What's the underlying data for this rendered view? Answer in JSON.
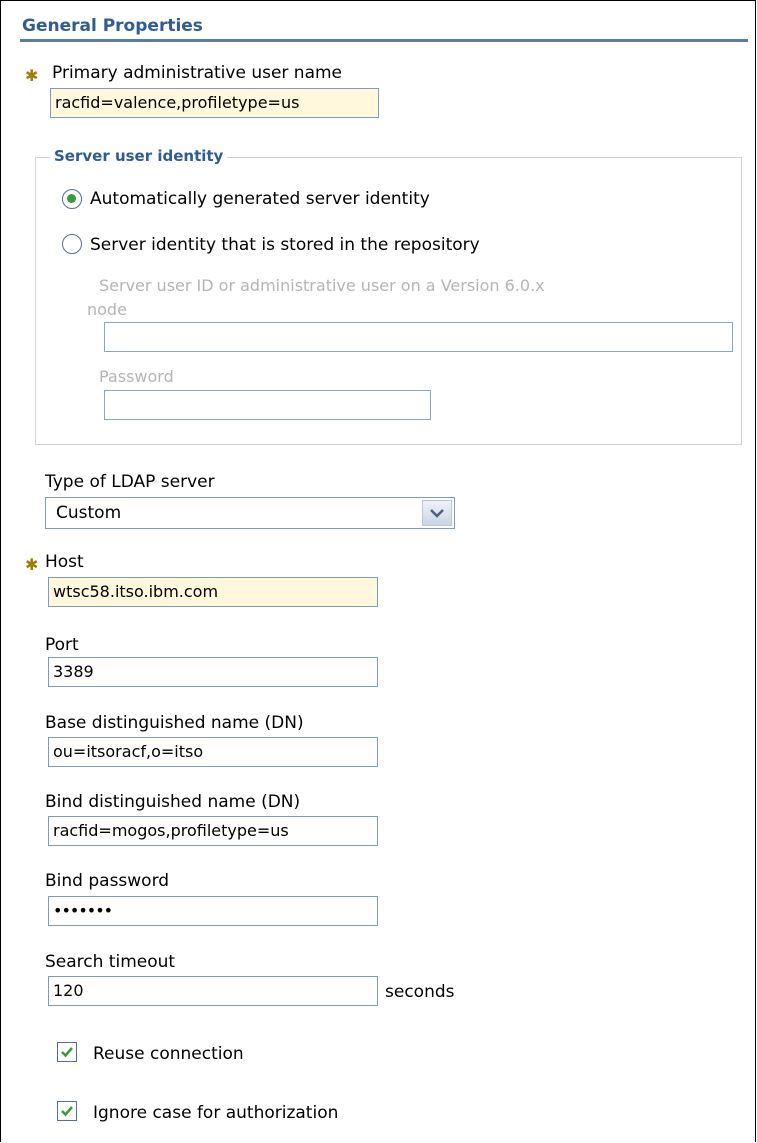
{
  "section": {
    "title": "General Properties"
  },
  "primary_admin": {
    "label": "Primary administrative user name",
    "value": "racfid=valence,profiletype=us"
  },
  "server_identity": {
    "legend": "Server user identity",
    "options": [
      {
        "label": "Automatically generated server identity",
        "selected": true
      },
      {
        "label": "Server identity that is stored in the repository",
        "selected": false
      }
    ],
    "server_user_id": {
      "label_line1": "Server user ID or administrative user on a Version 6.0.x",
      "label_line2": "node",
      "value": ""
    },
    "password": {
      "label": "Password",
      "value": ""
    }
  },
  "ldap_type": {
    "label": "Type of LDAP server",
    "selected": "Custom"
  },
  "host": {
    "label": "Host",
    "value": "wtsc58.itso.ibm.com"
  },
  "port": {
    "label": "Port",
    "value": "3389"
  },
  "base_dn": {
    "label": "Base distinguished name (DN)",
    "value": "ou=itsoracf,o=itso"
  },
  "bind_dn": {
    "label": "Bind distinguished name (DN)",
    "value": "racfid=mogos,profiletype=us"
  },
  "bind_password": {
    "label": "Bind password",
    "value": "•••••••"
  },
  "search_timeout": {
    "label": "Search timeout",
    "value": "120",
    "unit": "seconds"
  },
  "reuse_connection": {
    "label": "Reuse connection",
    "checked": true
  },
  "ignore_case": {
    "label": "Ignore case for authorization",
    "checked": true
  },
  "colors": {
    "heading": "#305c90",
    "required_bg": "#fff8dc",
    "input_border": "#7f9db9",
    "check_green": "#3a9a3a"
  }
}
